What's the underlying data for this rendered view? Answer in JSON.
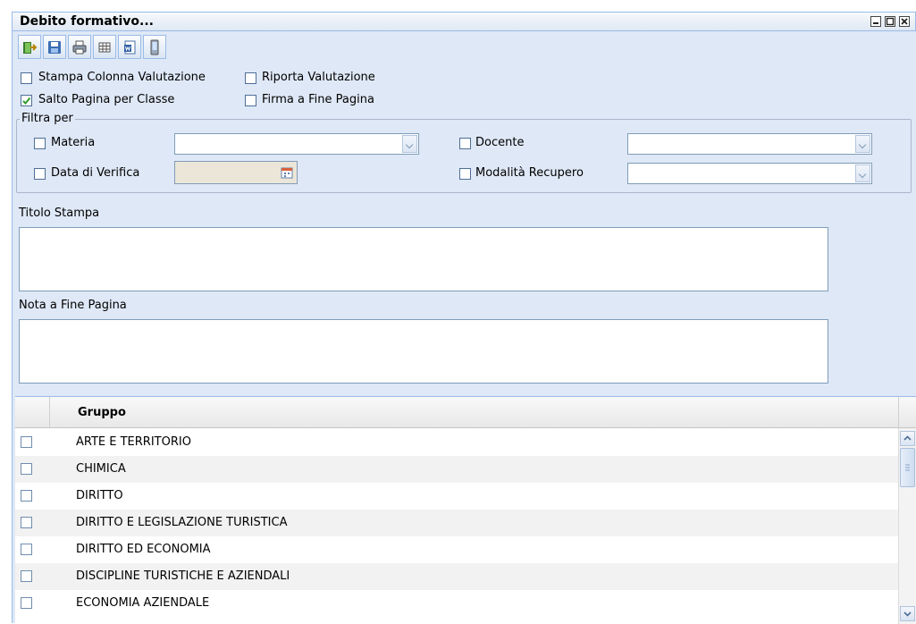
{
  "window": {
    "title": "Debito formativo...",
    "buttons": [
      "minimize-icon",
      "maximize-icon",
      "close-icon"
    ]
  },
  "toolbar": {
    "buttons": [
      {
        "icon": "exit-icon"
      },
      {
        "icon": "save-icon"
      },
      {
        "icon": "print-icon"
      },
      {
        "icon": "grid-icon"
      },
      {
        "icon": "document-icon"
      },
      {
        "icon": "mobile-icon"
      }
    ]
  },
  "options": {
    "stampa_colonna": {
      "label": "Stampa Colonna Valutazione",
      "checked": false
    },
    "riporta_valutazione": {
      "label": "Riporta Valutazione",
      "checked": false
    },
    "salto_pagina": {
      "label": "Salto Pagina per Classe",
      "checked": true
    },
    "firma_fine_pagina": {
      "label": "Firma a Fine Pagina",
      "checked": false
    }
  },
  "filter": {
    "legend": "Filtra per",
    "materia": {
      "label": "Materia",
      "value": ""
    },
    "data_verifica": {
      "label": "Data di Verifica",
      "value": ""
    },
    "docente": {
      "label": "Docente",
      "value": ""
    },
    "modalita_recupero": {
      "label": "Modalità Recupero",
      "value": ""
    }
  },
  "titolo_stampa": {
    "label": "Titolo Stampa",
    "value": ""
  },
  "nota_fine_pagina": {
    "label": "Nota a Fine Pagina",
    "value": ""
  },
  "grid": {
    "header": "Gruppo",
    "rows": [
      "ARTE E TERRITORIO",
      "CHIMICA",
      "DIRITTO",
      "DIRITTO E LEGISLAZIONE TURISTICA",
      "DIRITTO ED ECONOMIA",
      "DISCIPLINE TURISTICHE E AZIENDALI",
      "ECONOMIA AZIENDALE"
    ]
  },
  "colors": {
    "panel_bg": "#dfe8f6",
    "border": "#99bbe8",
    "checkbox_check": "#2e9c2e"
  }
}
